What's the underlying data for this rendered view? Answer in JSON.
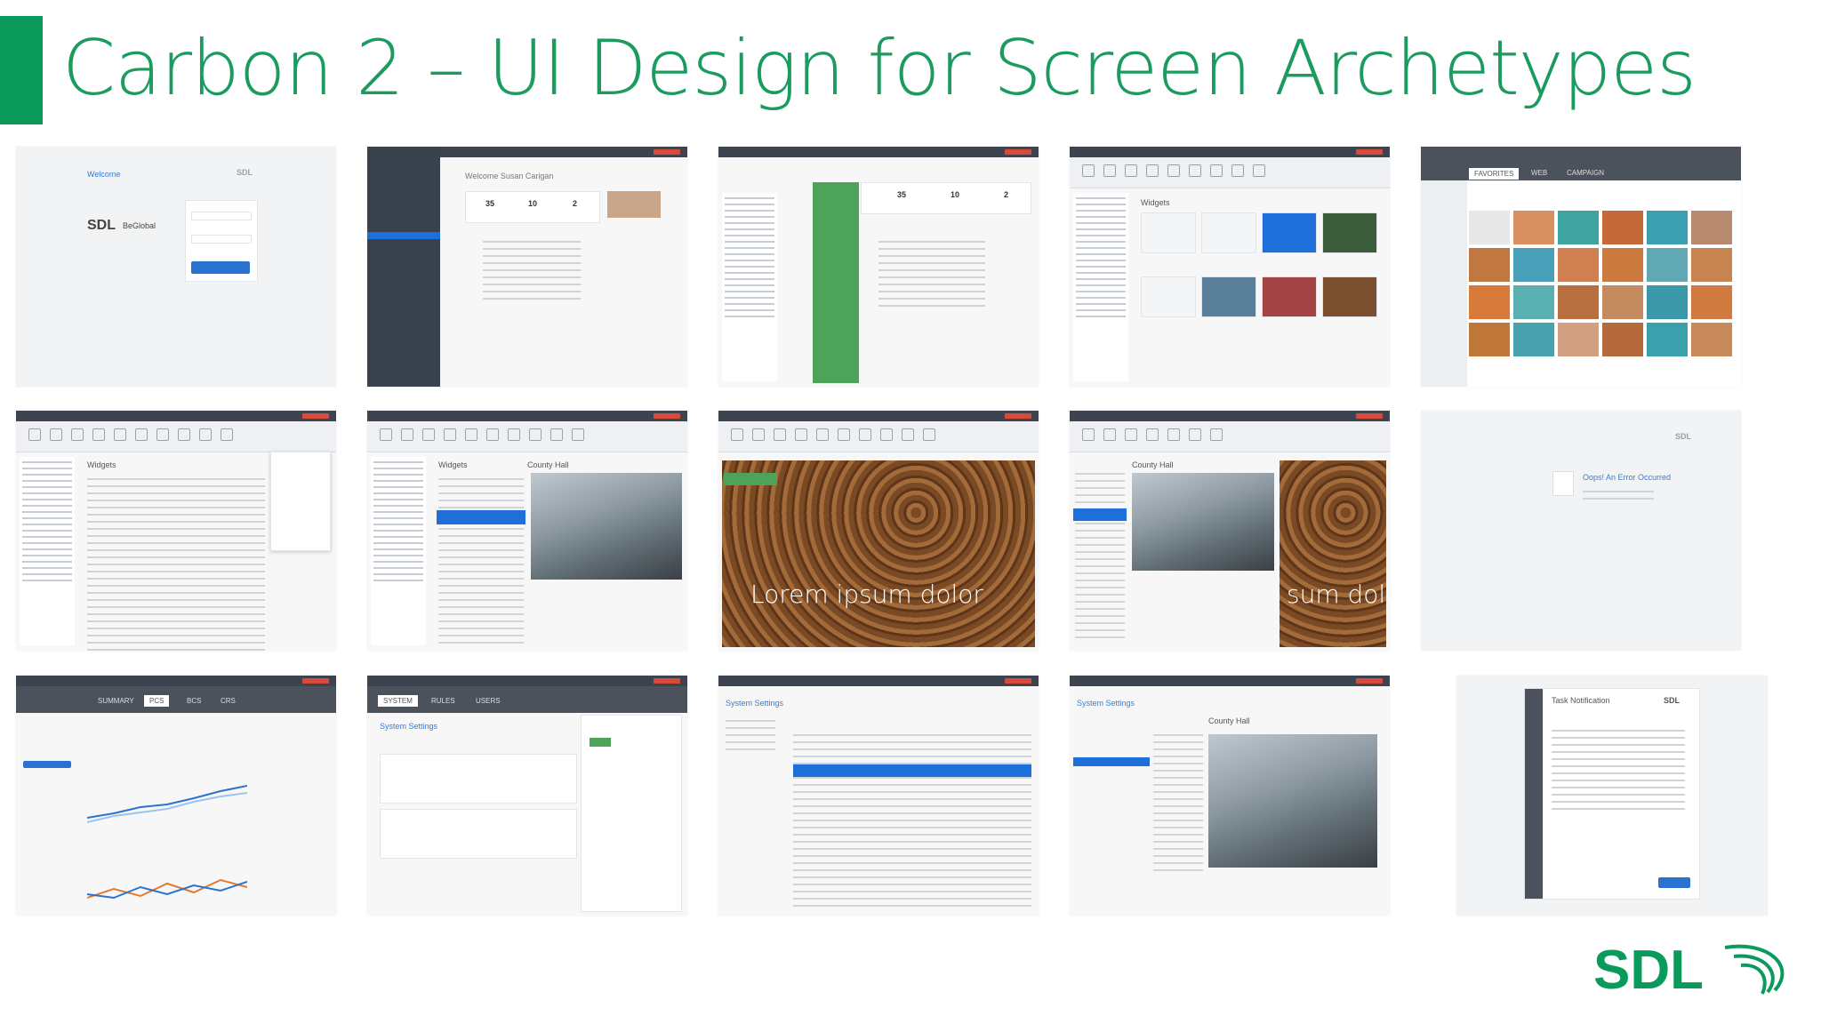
{
  "slide": {
    "title": "Carbon 2 – UI Design for Screen Archetypes",
    "accent_color": "#0a9b5c",
    "title_color": "#1b9b5e"
  },
  "thumbnails": [
    {
      "name": "login",
      "labels": [
        "Welcome",
        "SDL",
        "BeGlobal",
        "Login"
      ]
    },
    {
      "name": "dashboard",
      "labels": [
        "Welcome Susan Carigan",
        "35",
        "10",
        "2"
      ]
    },
    {
      "name": "dashboard-green",
      "labels": [
        "35",
        "10",
        "2"
      ]
    },
    {
      "name": "widgets-grid",
      "labels": [
        "Widgets"
      ]
    },
    {
      "name": "image-gallery",
      "labels": [
        "FAVORITES",
        "WEB",
        "CAMPAIGN"
      ]
    },
    {
      "name": "list-view-menu",
      "labels": [
        "Widgets"
      ]
    },
    {
      "name": "list-with-preview",
      "labels": [
        "Widgets",
        "County Hall"
      ]
    },
    {
      "name": "website-preview",
      "labels": [
        "Lorem ipsum dolor"
      ]
    },
    {
      "name": "split-preview",
      "labels": [
        "County Hall",
        "sum dolc"
      ]
    },
    {
      "name": "error-page",
      "labels": [
        "SDL",
        "Oops! An Error Occurred"
      ]
    },
    {
      "name": "analytics",
      "labels": [
        "SUMMARY",
        "PCS",
        "BCS",
        "CRS"
      ]
    },
    {
      "name": "system-settings-rules",
      "labels": [
        "SYSTEM",
        "RULES",
        "USERS",
        "System Settings"
      ]
    },
    {
      "name": "system-settings-list",
      "labels": [
        "System Settings"
      ]
    },
    {
      "name": "system-settings-preview",
      "labels": [
        "System Settings",
        "County Hall"
      ]
    },
    {
      "name": "task-notification",
      "labels": [
        "Task Notification",
        "SDL"
      ]
    }
  ],
  "logo": {
    "text": "SDL",
    "color": "#0a9b5c"
  }
}
